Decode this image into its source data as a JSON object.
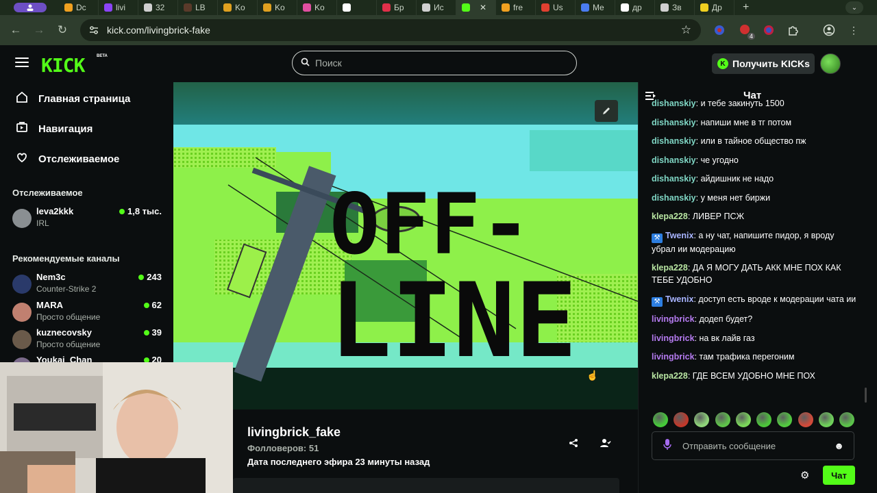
{
  "browser": {
    "tabs": [
      {
        "label": "Dc",
        "color": "#f0a020"
      },
      {
        "label": "livi",
        "color": "#8b44f7"
      },
      {
        "label": "32",
        "color": "#d0d0d0"
      },
      {
        "label": "LB",
        "color": "#5a3a2a"
      },
      {
        "label": "Ko",
        "color": "#e0a020"
      },
      {
        "label": "Ko",
        "color": "#e0a020"
      },
      {
        "label": "Ko",
        "color": "#e04fa0"
      },
      {
        "label": "",
        "color": "#ffffff"
      },
      {
        "label": "Бр",
        "color": "#e0304a"
      },
      {
        "label": "Ис",
        "color": "#d0d0d0"
      },
      {
        "label": "",
        "color": "#53fc18",
        "active": true
      },
      {
        "label": "fre",
        "color": "#f0a020"
      },
      {
        "label": "Us",
        "color": "#e04030"
      },
      {
        "label": "Me",
        "color": "#4a7cf0"
      },
      {
        "label": "др",
        "color": "#ffffff"
      },
      {
        "label": "Зв",
        "color": "#d0d0d0"
      },
      {
        "label": "Др",
        "color": "#f0d020"
      }
    ],
    "url": "kick.com/livingbrick-fake",
    "extension_badge": "4"
  },
  "header": {
    "logo": "KICK",
    "logo_badge": "BETA",
    "search_placeholder": "Поиск",
    "get_kicks_label": "Получить KICKs"
  },
  "sidebar": {
    "nav": [
      {
        "label": "Главная страница",
        "icon": "home-icon"
      },
      {
        "label": "Навигация",
        "icon": "browse-icon"
      },
      {
        "label": "Отслеживаемое",
        "icon": "heart-icon"
      }
    ],
    "following_title": "Отслеживаемое",
    "following": [
      {
        "name": "leva2kkk",
        "sub": "IRL",
        "viewers": "1,8 тыс.",
        "color": "#8a8f92"
      }
    ],
    "recommended_title": "Рекомендуемые каналы",
    "recommended": [
      {
        "name": "Nem3c",
        "sub": "Counter-Strike 2",
        "viewers": "243",
        "color": "#2a3a6a"
      },
      {
        "name": "MARA",
        "sub": "Просто общение",
        "viewers": "62",
        "color": "#c08070"
      },
      {
        "name": "kuznecovsky",
        "sub": "Просто общение",
        "viewers": "39",
        "color": "#6a5a4a"
      },
      {
        "name": "Youkai_Chan",
        "sub": "",
        "viewers": "20",
        "color": "#7a6a8a"
      }
    ]
  },
  "player": {
    "offline_line1": "OFF-",
    "offline_line2": "LINE"
  },
  "channel": {
    "name": "livingbrick_fake",
    "followers": "Фолловеров: 51",
    "last_live": "Дата последнего эфира 23 минуты назад"
  },
  "chat": {
    "title": "Чат",
    "messages": [
      {
        "user": "dishanskiy",
        "cls": "u-dish",
        "text": "и тебе закинуть 1500",
        "badge": false
      },
      {
        "user": "dishanskiy",
        "cls": "u-dish",
        "text": "напиши мне в тг потом",
        "badge": false
      },
      {
        "user": "dishanskiy",
        "cls": "u-dish",
        "text": "или в тайное общество пж",
        "badge": false
      },
      {
        "user": "dishanskiy",
        "cls": "u-dish",
        "text": "че угодно",
        "badge": false
      },
      {
        "user": "dishanskiy",
        "cls": "u-dish",
        "text": "айдишник не надо",
        "badge": false
      },
      {
        "user": "dishanskiy",
        "cls": "u-dish",
        "text": "у меня нет биржи",
        "badge": false
      },
      {
        "user": "klepa228",
        "cls": "u-klepa",
        "text": "ЛИВЕР ПСЖ",
        "badge": false
      },
      {
        "user": "Twenix",
        "cls": "u-twenix",
        "text": "а ну чат, напишите пидор, я вроду убрал ии модерацию",
        "badge": true
      },
      {
        "user": "klepa228",
        "cls": "u-klepa",
        "text": "ДА Я МОГУ ДАТЬ АКК МНЕ ПОХ КАК ТЕБЕ УДОБНО",
        "badge": false
      },
      {
        "user": "Twenix",
        "cls": "u-twenix",
        "text": "доступ есть вроде к модерации чата ии",
        "badge": true
      },
      {
        "user": "livingbrick",
        "cls": "u-living",
        "text": "додеп будет?",
        "badge": false
      },
      {
        "user": "livingbrick",
        "cls": "u-living",
        "text": "на вк лайв газ",
        "badge": false
      },
      {
        "user": "livingbrick",
        "cls": "u-living",
        "text": "там трафика перегоним",
        "badge": false
      },
      {
        "user": "klepa228",
        "cls": "u-klepa",
        "text": "ГДЕ ВСЕМ УДОБНО МНЕ ПОХ",
        "badge": false
      }
    ],
    "emotes": [
      "#46c93a",
      "#c0392b",
      "#8fd47a",
      "#5ec24a",
      "#7ad65a",
      "#4cc43a",
      "#52c840",
      "#d04a3a",
      "#6ed05a",
      "#5bc24a"
    ],
    "input_placeholder": "Отправить сообщение",
    "send_label": "Чат"
  }
}
